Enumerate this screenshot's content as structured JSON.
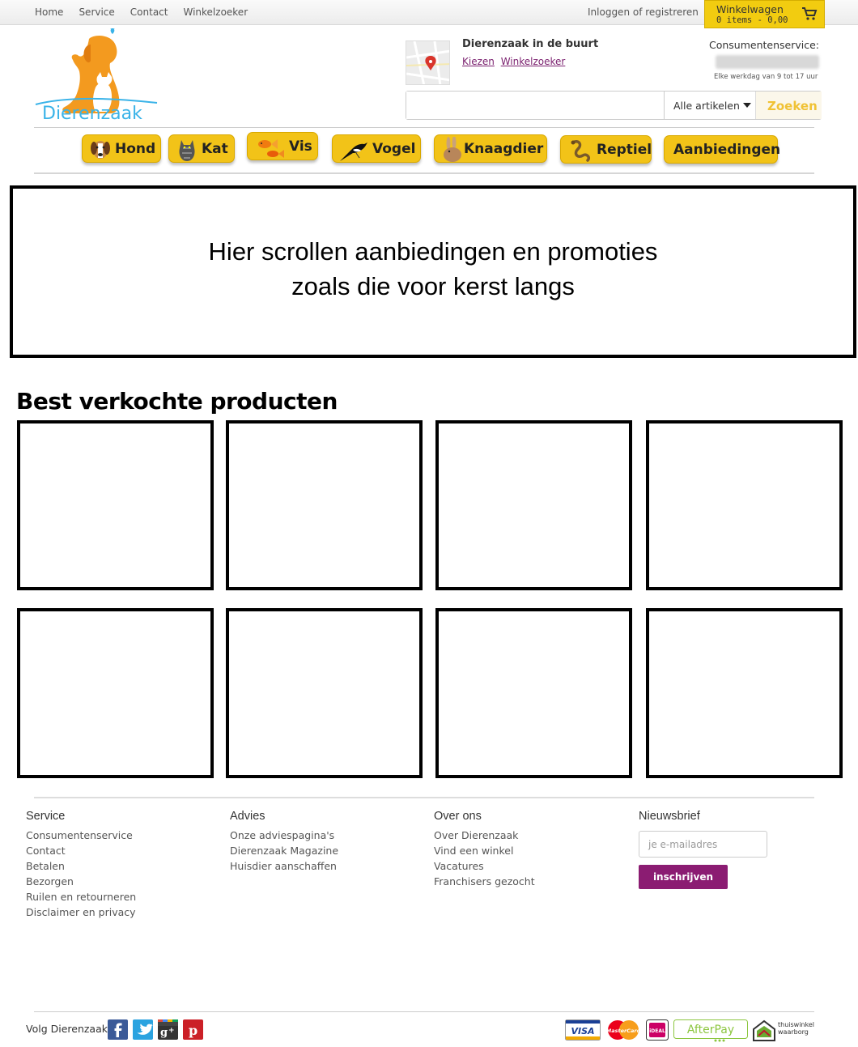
{
  "topnav": {
    "items": [
      "Home",
      "Service",
      "Contact",
      "Winkelzoeker"
    ],
    "login": "Inloggen of registreren"
  },
  "cart": {
    "title": "Winkelwagen",
    "summary": "0 items - 0,00"
  },
  "brand": {
    "name": "Dierenzaak"
  },
  "nearby": {
    "title": "Dierenzaak in de buurt",
    "link_choose": "Kiezen",
    "link_finder": "Winkelzoeker"
  },
  "service": {
    "title": "Consumentenservice:",
    "hours": "Elke werkdag van 9 tot 17 uur"
  },
  "search": {
    "value": "",
    "category": "Alle artikelen",
    "button": "Zoeken"
  },
  "categories": [
    "Hond",
    "Kat",
    "Vis",
    "Vogel",
    "Knaagdier",
    "Reptiel",
    "Aanbiedingen"
  ],
  "banner": {
    "line1": "Hier scrollen aanbiedingen en promoties",
    "line2": "zoals die voor kerst langs"
  },
  "bestsellers": {
    "title": "Best verkochte producten"
  },
  "footer": {
    "service": {
      "title": "Service",
      "items": [
        "Consumentenservice",
        "Contact",
        "Betalen",
        "Bezorgen",
        "Ruilen en retourneren",
        "Disclaimer en privacy"
      ]
    },
    "advies": {
      "title": "Advies",
      "items": [
        "Onze adviespagina's",
        "Dierenzaak Magazine",
        "Huisdier aanschaffen"
      ]
    },
    "over": {
      "title": "Over ons",
      "items": [
        "Over Dierenzaak",
        "Vind een winkel",
        "Vacatures",
        "Franchisers gezocht"
      ]
    },
    "newsletter": {
      "title": "Nieuwsbrief",
      "placeholder": "je e-mailadres",
      "button": "inschrijven"
    },
    "follow": "Volg Dierenzaak",
    "payments": {
      "visa": "VISA",
      "mastercard": "MasterCard",
      "ideal": "iDEAL",
      "afterpay": "AfterPay",
      "thuiswinkel": "thuiswinkel waarborg"
    }
  },
  "colors": {
    "accent": "#f2c318",
    "purple": "#8b1c72",
    "link": "#7a1f6e"
  }
}
